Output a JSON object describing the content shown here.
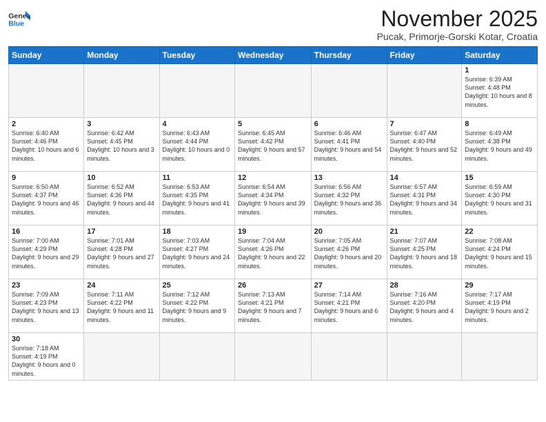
{
  "header": {
    "logo_general": "General",
    "logo_blue": "Blue",
    "month_title": "November 2025",
    "location": "Pucak, Primorje-Gorski Kotar, Croatia"
  },
  "days_of_week": [
    "Sunday",
    "Monday",
    "Tuesday",
    "Wednesday",
    "Thursday",
    "Friday",
    "Saturday"
  ],
  "weeks": [
    [
      {
        "day": "",
        "info": ""
      },
      {
        "day": "",
        "info": ""
      },
      {
        "day": "",
        "info": ""
      },
      {
        "day": "",
        "info": ""
      },
      {
        "day": "",
        "info": ""
      },
      {
        "day": "",
        "info": ""
      },
      {
        "day": "1",
        "info": "Sunrise: 6:39 AM\nSunset: 4:48 PM\nDaylight: 10 hours and 8 minutes."
      }
    ],
    [
      {
        "day": "2",
        "info": "Sunrise: 6:40 AM\nSunset: 4:46 PM\nDaylight: 10 hours and 6 minutes."
      },
      {
        "day": "3",
        "info": "Sunrise: 6:42 AM\nSunset: 4:45 PM\nDaylight: 10 hours and 3 minutes."
      },
      {
        "day": "4",
        "info": "Sunrise: 6:43 AM\nSunset: 4:44 PM\nDaylight: 10 hours and 0 minutes."
      },
      {
        "day": "5",
        "info": "Sunrise: 6:45 AM\nSunset: 4:42 PM\nDaylight: 9 hours and 57 minutes."
      },
      {
        "day": "6",
        "info": "Sunrise: 6:46 AM\nSunset: 4:41 PM\nDaylight: 9 hours and 54 minutes."
      },
      {
        "day": "7",
        "info": "Sunrise: 6:47 AM\nSunset: 4:40 PM\nDaylight: 9 hours and 52 minutes."
      },
      {
        "day": "8",
        "info": "Sunrise: 6:49 AM\nSunset: 4:38 PM\nDaylight: 9 hours and 49 minutes."
      }
    ],
    [
      {
        "day": "9",
        "info": "Sunrise: 6:50 AM\nSunset: 4:37 PM\nDaylight: 9 hours and 46 minutes."
      },
      {
        "day": "10",
        "info": "Sunrise: 6:52 AM\nSunset: 4:36 PM\nDaylight: 9 hours and 44 minutes."
      },
      {
        "day": "11",
        "info": "Sunrise: 6:53 AM\nSunset: 4:35 PM\nDaylight: 9 hours and 41 minutes."
      },
      {
        "day": "12",
        "info": "Sunrise: 6:54 AM\nSunset: 4:34 PM\nDaylight: 9 hours and 39 minutes."
      },
      {
        "day": "13",
        "info": "Sunrise: 6:56 AM\nSunset: 4:32 PM\nDaylight: 9 hours and 36 minutes."
      },
      {
        "day": "14",
        "info": "Sunrise: 6:57 AM\nSunset: 4:31 PM\nDaylight: 9 hours and 34 minutes."
      },
      {
        "day": "15",
        "info": "Sunrise: 6:59 AM\nSunset: 4:30 PM\nDaylight: 9 hours and 31 minutes."
      }
    ],
    [
      {
        "day": "16",
        "info": "Sunrise: 7:00 AM\nSunset: 4:29 PM\nDaylight: 9 hours and 29 minutes."
      },
      {
        "day": "17",
        "info": "Sunrise: 7:01 AM\nSunset: 4:28 PM\nDaylight: 9 hours and 27 minutes."
      },
      {
        "day": "18",
        "info": "Sunrise: 7:03 AM\nSunset: 4:27 PM\nDaylight: 9 hours and 24 minutes."
      },
      {
        "day": "19",
        "info": "Sunrise: 7:04 AM\nSunset: 4:26 PM\nDaylight: 9 hours and 22 minutes."
      },
      {
        "day": "20",
        "info": "Sunrise: 7:05 AM\nSunset: 4:26 PM\nDaylight: 9 hours and 20 minutes."
      },
      {
        "day": "21",
        "info": "Sunrise: 7:07 AM\nSunset: 4:25 PM\nDaylight: 9 hours and 18 minutes."
      },
      {
        "day": "22",
        "info": "Sunrise: 7:08 AM\nSunset: 4:24 PM\nDaylight: 9 hours and 15 minutes."
      }
    ],
    [
      {
        "day": "23",
        "info": "Sunrise: 7:09 AM\nSunset: 4:23 PM\nDaylight: 9 hours and 13 minutes."
      },
      {
        "day": "24",
        "info": "Sunrise: 7:11 AM\nSunset: 4:22 PM\nDaylight: 9 hours and 11 minutes."
      },
      {
        "day": "25",
        "info": "Sunrise: 7:12 AM\nSunset: 4:22 PM\nDaylight: 9 hours and 9 minutes."
      },
      {
        "day": "26",
        "info": "Sunrise: 7:13 AM\nSunset: 4:21 PM\nDaylight: 9 hours and 7 minutes."
      },
      {
        "day": "27",
        "info": "Sunrise: 7:14 AM\nSunset: 4:21 PM\nDaylight: 9 hours and 6 minutes."
      },
      {
        "day": "28",
        "info": "Sunrise: 7:16 AM\nSunset: 4:20 PM\nDaylight: 9 hours and 4 minutes."
      },
      {
        "day": "29",
        "info": "Sunrise: 7:17 AM\nSunset: 4:19 PM\nDaylight: 9 hours and 2 minutes."
      }
    ],
    [
      {
        "day": "30",
        "info": "Sunrise: 7:18 AM\nSunset: 4:19 PM\nDaylight: 9 hours and 0 minutes."
      },
      {
        "day": "",
        "info": ""
      },
      {
        "day": "",
        "info": ""
      },
      {
        "day": "",
        "info": ""
      },
      {
        "day": "",
        "info": ""
      },
      {
        "day": "",
        "info": ""
      },
      {
        "day": "",
        "info": ""
      }
    ]
  ]
}
